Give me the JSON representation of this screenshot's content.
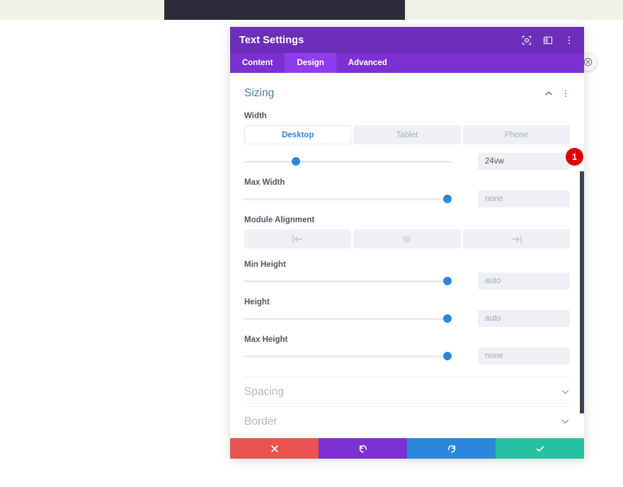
{
  "backdrop": {
    "cream_color": "#f2f1e6",
    "dark_bar_color": "#2b2b3a",
    "page_close_icon": "close-circle-icon"
  },
  "modal": {
    "title": "Text Settings",
    "header_color": "#6c2eb9",
    "tabs_bar_color": "#7b31d2",
    "header_icons": [
      {
        "name": "target-icon"
      },
      {
        "name": "layout-panel-icon"
      },
      {
        "name": "vertical-dots-icon"
      }
    ],
    "tabs": [
      {
        "label": "Content",
        "active": false
      },
      {
        "label": "Design",
        "active": true
      },
      {
        "label": "Advanced",
        "active": false
      }
    ],
    "open_section": {
      "title": "Sizing",
      "title_color": "#4a7fa8",
      "collapse_icon": "chevron-up-icon",
      "menu_icon": "vertical-dots-icon",
      "fields": [
        {
          "id": "width",
          "label": "Width",
          "device_tabs": [
            {
              "label": "Desktop",
              "active": true
            },
            {
              "label": "Tablet",
              "active": false
            },
            {
              "label": "Phone",
              "active": false
            }
          ],
          "slider_percent": 25,
          "value": "24vw",
          "value_is_placeholder": false,
          "badge": "1",
          "badge_color": "#dd0000"
        },
        {
          "id": "max-width",
          "label": "Max Width",
          "slider_percent": 98,
          "value": "none",
          "value_is_placeholder": true
        },
        {
          "id": "module-alignment",
          "label": "Module Alignment",
          "alignment_options": [
            {
              "icon": "align-left-icon",
              "active": false
            },
            {
              "icon": "align-center-icon",
              "active": false
            },
            {
              "icon": "align-right-icon",
              "active": false
            }
          ]
        },
        {
          "id": "min-height",
          "label": "Min Height",
          "slider_percent": 98,
          "value": "auto",
          "value_is_placeholder": true
        },
        {
          "id": "height",
          "label": "Height",
          "slider_percent": 98,
          "value": "auto",
          "value_is_placeholder": true
        },
        {
          "id": "max-height",
          "label": "Max Height",
          "slider_percent": 98,
          "value": "none",
          "value_is_placeholder": true
        }
      ]
    },
    "closed_sections": [
      {
        "title": "Spacing",
        "chevron": "chevron-down-icon"
      },
      {
        "title": "Border",
        "chevron": "chevron-down-icon"
      }
    ],
    "footer_buttons": [
      {
        "name": "discard-button",
        "icon": "x-icon",
        "color": "#e8534e"
      },
      {
        "name": "undo-button",
        "icon": "undo-icon",
        "color": "#7b31d2"
      },
      {
        "name": "redo-button",
        "icon": "redo-icon",
        "color": "#2b87da"
      },
      {
        "name": "save-button",
        "icon": "check-icon",
        "color": "#24c2a0"
      }
    ],
    "scrollbar_color": "#3b4350"
  }
}
